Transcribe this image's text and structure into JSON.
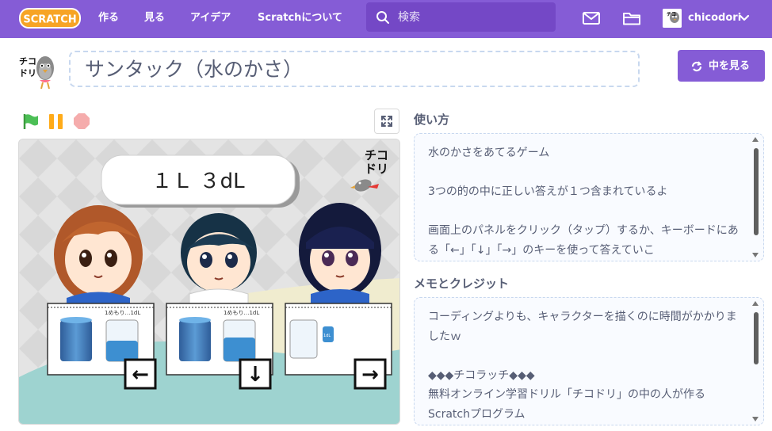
{
  "nav": {
    "logo_text": "SCRATCH",
    "links": [
      "作る",
      "見る",
      "アイデア",
      "Scratchについて"
    ],
    "search_placeholder": "検索",
    "icons": [
      "mail-icon",
      "folder-icon"
    ],
    "username": "chicodori"
  },
  "project": {
    "title": "サンタック（水のかさ）",
    "see_inside_label": "中を見る",
    "author_logo_text": "チコドリ"
  },
  "stage": {
    "question": "１Ｌ ３dL",
    "logo_text": "チコドリ",
    "panel_scale_label": "1めもり…1dL",
    "arrow_keys": [
      "←",
      "↓",
      "→"
    ],
    "cup_label": "1dL",
    "colors": {
      "water": "#3d8fd1",
      "pillar": "#4a7fb5"
    }
  },
  "instructions": {
    "heading": "使い方",
    "text": "水のかさをあてるゲーム\n\n3つの的の中に正しい答えが１つ含まれているよ\n\n画面上のパネルをクリック（タップ）するか、キーボードにある「←」「↓」「→」のキーを使って答えていこ"
  },
  "notes": {
    "heading": "メモとクレジット",
    "text": "コーディングよりも、キャラクターを描くのに時間がかかりましたｗ\n\n◆◆◆チコラッチ◆◆◆\n無料オンライン学習ドリル「チコドリ」の中の人が作るScratchプログラム"
  },
  "colors": {
    "nav_bg": "#855cd6",
    "text": "#575e75",
    "green_flag": "#4cbf56",
    "pause": "#ffab19",
    "stop": "#ec5959"
  }
}
